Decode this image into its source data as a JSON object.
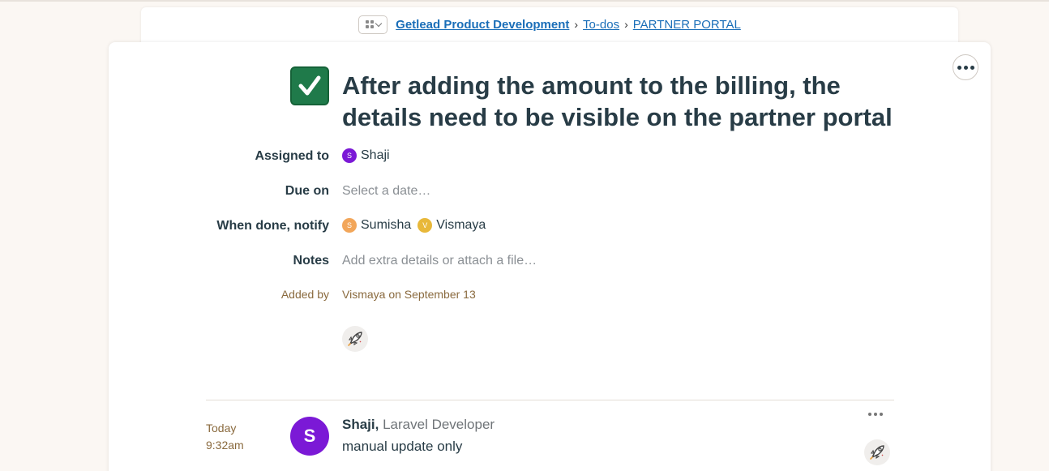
{
  "breadcrumb": {
    "project": "Getlead Product Development",
    "section": "To-dos",
    "list": "PARTNER PORTAL",
    "separator": "›"
  },
  "todo": {
    "title": "After adding the amount to the billing, the details need to be visible on the partner portal",
    "completed": true,
    "assigned_label": "Assigned to",
    "assignee": {
      "initial": "S",
      "name": "Shaji",
      "color": "#7b19d6"
    },
    "due_label": "Due on",
    "due_placeholder": "Select a date…",
    "notify_label": "When done, notify",
    "notify": [
      {
        "initial": "S",
        "name": "Sumisha",
        "color": "#f2a65a"
      },
      {
        "initial": "V",
        "name": "Vismaya",
        "color": "#e8b83a"
      }
    ],
    "notes_label": "Notes",
    "notes_placeholder": "Add extra details or attach a file…",
    "added_label": "Added by",
    "added_value": "Vismaya on September 13"
  },
  "comment": {
    "day": "Today",
    "time": "9:32am",
    "initial": "S",
    "author": "Shaji,",
    "role": "Laravel Developer",
    "text": "manual update only"
  },
  "icons": {
    "project_switcher": "grid-icon",
    "options": "ellipsis-icon",
    "boost": "rocket-boost-icon",
    "complete": "checkmark-icon"
  }
}
